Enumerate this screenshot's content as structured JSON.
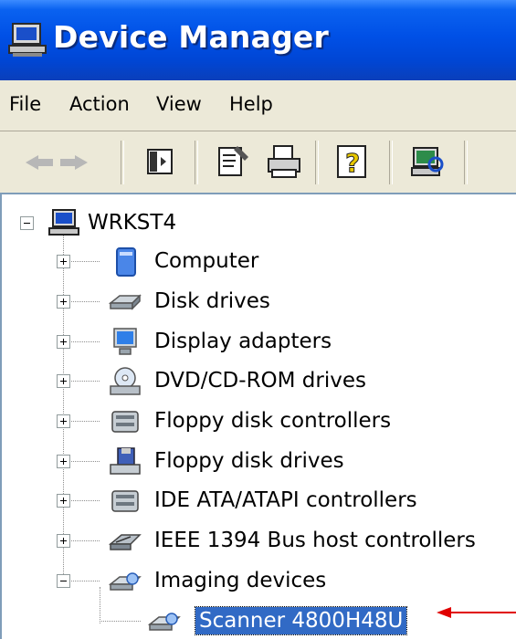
{
  "window": {
    "title": "Device Manager"
  },
  "menu": [
    "File",
    "Action",
    "View",
    "Help"
  ],
  "toolbar": {
    "buttons": [
      "back-icon",
      "forward-icon",
      "show-hide-console-tree-icon",
      "properties-icon",
      "print-icon",
      "help-icon",
      "scan-hardware-icon"
    ]
  },
  "tree": {
    "root": "WRKST4",
    "items": [
      "Computer",
      "Disk drives",
      "Display adapters",
      "DVD/CD-ROM drives",
      "Floppy disk controllers",
      "Floppy disk drives",
      "IDE ATA/ATAPI controllers",
      "IEEE 1394 Bus host controllers",
      "Imaging devices"
    ],
    "selected_child": "Scanner 4800H48U"
  },
  "colors": {
    "title_blue": "#0050e6",
    "selection": "#316ac5",
    "arrow": "#e00000"
  }
}
